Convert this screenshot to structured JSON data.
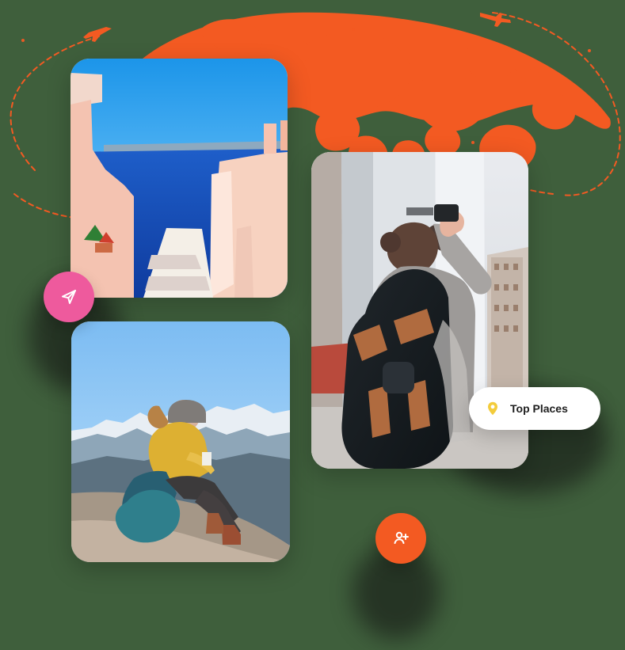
{
  "scene": {
    "accent": "#f35a22",
    "accent_pink": "#ee5a9d",
    "pin_color": "#f3cc3c"
  },
  "badges": {
    "top_places_label": "Top Places"
  },
  "icons": {
    "send": "send-icon",
    "user_add": "user-plus-icon",
    "pin": "map-pin-icon",
    "plane": "airplane-icon",
    "location": "location-marker-icon"
  }
}
